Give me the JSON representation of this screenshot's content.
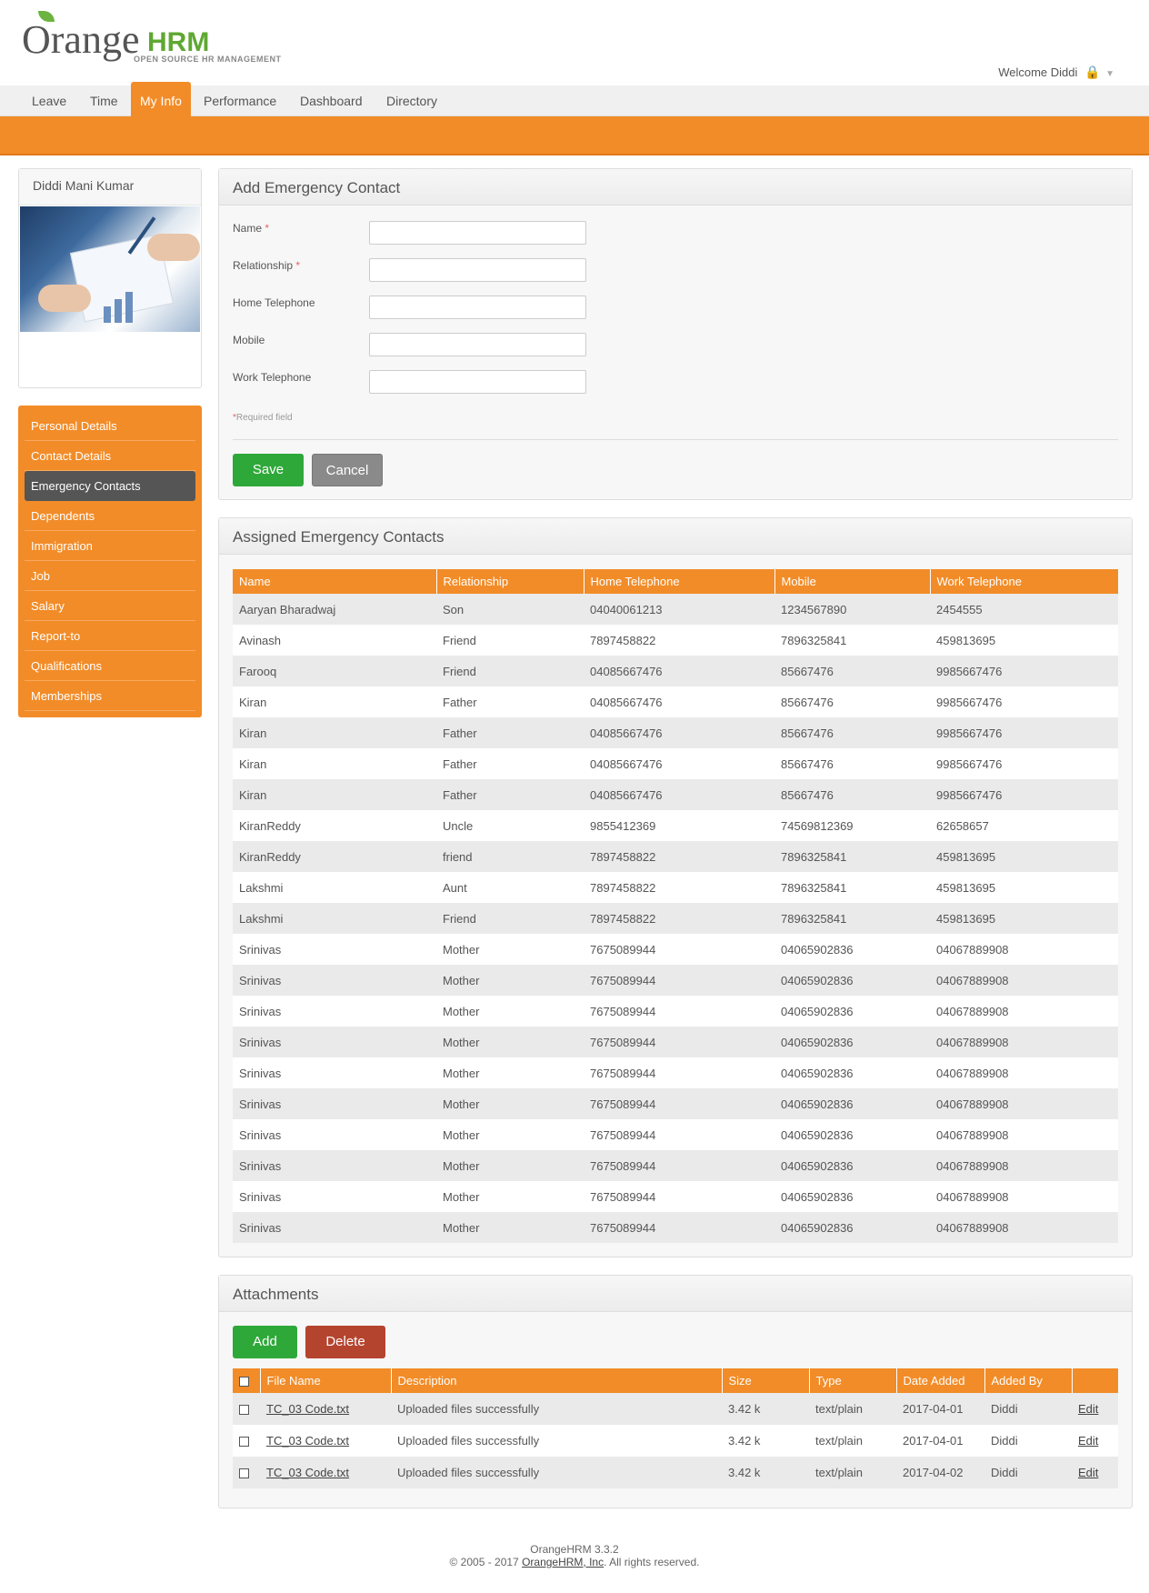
{
  "header": {
    "logo_orange": "Orange",
    "logo_hrm": "HRM",
    "logo_tagline": "OPEN SOURCE HR MANAGEMENT",
    "welcome": "Welcome Diddi"
  },
  "nav": {
    "items": [
      "Leave",
      "Time",
      "My Info",
      "Performance",
      "Dashboard",
      "Directory"
    ],
    "active": "My Info"
  },
  "profile": {
    "name": "Diddi Mani Kumar"
  },
  "sidemenu": {
    "items": [
      "Personal Details",
      "Contact Details",
      "Emergency Contacts",
      "Dependents",
      "Immigration",
      "Job",
      "Salary",
      "Report-to",
      "Qualifications",
      "Memberships"
    ],
    "active": "Emergency Contacts"
  },
  "add_form": {
    "title": "Add Emergency Contact",
    "fields": [
      {
        "label": "Name",
        "required": true,
        "value": ""
      },
      {
        "label": "Relationship",
        "required": true,
        "value": ""
      },
      {
        "label": "Home Telephone",
        "required": false,
        "value": ""
      },
      {
        "label": "Mobile",
        "required": false,
        "value": ""
      },
      {
        "label": "Work Telephone",
        "required": false,
        "value": ""
      }
    ],
    "required_note": "Required field",
    "save_label": "Save",
    "cancel_label": "Cancel"
  },
  "assigned": {
    "title": "Assigned Emergency Contacts",
    "columns": [
      "Name",
      "Relationship",
      "Home Telephone",
      "Mobile",
      "Work Telephone"
    ],
    "rows": [
      [
        "Aaryan Bharadwaj",
        "Son",
        "04040061213",
        "1234567890",
        "2454555"
      ],
      [
        "Avinash",
        "Friend",
        "7897458822",
        "7896325841",
        "459813695"
      ],
      [
        "Farooq",
        "Friend",
        "04085667476",
        "85667476",
        "9985667476"
      ],
      [
        "Kiran",
        "Father",
        "04085667476",
        "85667476",
        "9985667476"
      ],
      [
        "Kiran",
        "Father",
        "04085667476",
        "85667476",
        "9985667476"
      ],
      [
        "Kiran",
        "Father",
        "04085667476",
        "85667476",
        "9985667476"
      ],
      [
        "Kiran",
        "Father",
        "04085667476",
        "85667476",
        "9985667476"
      ],
      [
        "KiranReddy",
        "Uncle",
        "9855412369",
        "74569812369",
        "62658657"
      ],
      [
        "KiranReddy",
        "friend",
        "7897458822",
        "7896325841",
        "459813695"
      ],
      [
        "Lakshmi",
        "Aunt",
        "7897458822",
        "7896325841",
        "459813695"
      ],
      [
        "Lakshmi",
        "Friend",
        "7897458822",
        "7896325841",
        "459813695"
      ],
      [
        "Srinivas",
        "Mother",
        "7675089944",
        "04065902836",
        "04067889908"
      ],
      [
        "Srinivas",
        "Mother",
        "7675089944",
        "04065902836",
        "04067889908"
      ],
      [
        "Srinivas",
        "Mother",
        "7675089944",
        "04065902836",
        "04067889908"
      ],
      [
        "Srinivas",
        "Mother",
        "7675089944",
        "04065902836",
        "04067889908"
      ],
      [
        "Srinivas",
        "Mother",
        "7675089944",
        "04065902836",
        "04067889908"
      ],
      [
        "Srinivas",
        "Mother",
        "7675089944",
        "04065902836",
        "04067889908"
      ],
      [
        "Srinivas",
        "Mother",
        "7675089944",
        "04065902836",
        "04067889908"
      ],
      [
        "Srinivas",
        "Mother",
        "7675089944",
        "04065902836",
        "04067889908"
      ],
      [
        "Srinivas",
        "Mother",
        "7675089944",
        "04065902836",
        "04067889908"
      ],
      [
        "Srinivas",
        "Mother",
        "7675089944",
        "04065902836",
        "04067889908"
      ]
    ]
  },
  "attachments": {
    "title": "Attachments",
    "add_label": "Add",
    "delete_label": "Delete",
    "columns": [
      "File Name",
      "Description",
      "Size",
      "Type",
      "Date Added",
      "Added By"
    ],
    "rows": [
      {
        "file": "TC_03 Code.txt",
        "description": "Uploaded files successfully",
        "size": "3.42 k",
        "type": "text/plain",
        "date": "2017-04-01",
        "by": "Diddi",
        "edit": "Edit"
      },
      {
        "file": "TC_03 Code.txt",
        "description": "Uploaded files successfully",
        "size": "3.42 k",
        "type": "text/plain",
        "date": "2017-04-01",
        "by": "Diddi",
        "edit": "Edit"
      },
      {
        "file": "TC_03 Code.txt",
        "description": "Uploaded files successfully",
        "size": "3.42 k",
        "type": "text/plain",
        "date": "2017-04-02",
        "by": "Diddi",
        "edit": "Edit"
      }
    ]
  },
  "footer": {
    "version": "OrangeHRM 3.3.2",
    "copyright_prefix": "© 2005 - 2017 ",
    "company": "OrangeHRM, Inc",
    "copyright_suffix": ". All rights reserved."
  }
}
